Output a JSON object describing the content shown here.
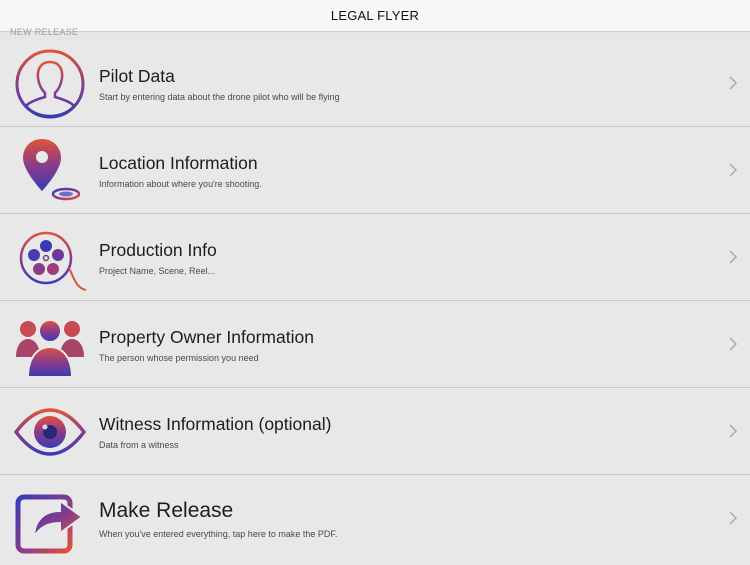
{
  "navbar": {
    "title": "LEGAL FLYER"
  },
  "ghost_text": "NEW RELEASE",
  "rows": [
    {
      "title": "Pilot Data",
      "subtitle": "Start by entering data about the drone pilot who will be flying",
      "icon": "pilot-icon"
    },
    {
      "title": "Location Information",
      "subtitle": "Information about where you're shooting.",
      "icon": "location-pin-icon"
    },
    {
      "title": "Production Info",
      "subtitle": "Project Name, Scene, Reel...",
      "icon": "film-reel-icon"
    },
    {
      "title": "Property Owner Information",
      "subtitle": "The person whose permission you need",
      "icon": "people-group-icon"
    },
    {
      "title": "Witness Information (optional)",
      "subtitle": "Data  from a witness",
      "icon": "eye-icon"
    },
    {
      "title": "Make Release",
      "subtitle": "When you've entered everything, tap here to make the PDF.",
      "icon": "share-arrow-icon"
    }
  ],
  "colors": {
    "gradient_top": "#e0533a",
    "gradient_bottom": "#3a3ab8",
    "chevron": "#b0b0b0"
  }
}
